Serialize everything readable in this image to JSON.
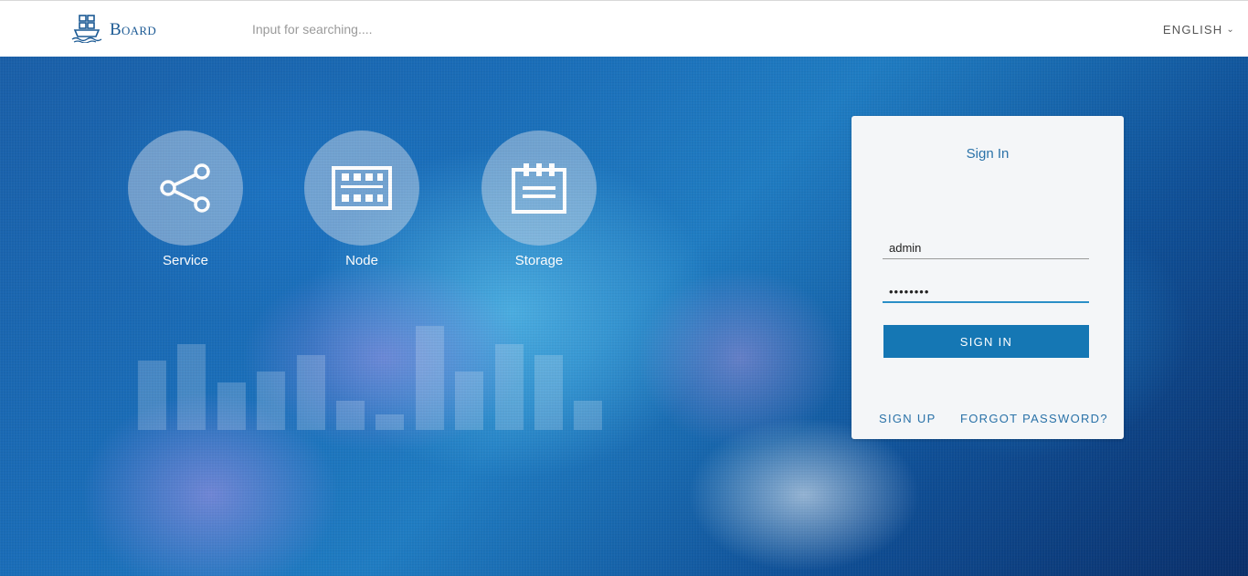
{
  "header": {
    "logo_text": "Board",
    "logo_icon": "ship-containers-icon",
    "search": {
      "placeholder": "Input for searching....",
      "value": ""
    },
    "language": "ENGLISH"
  },
  "features": [
    {
      "label": "Service",
      "icon": "share-icon"
    },
    {
      "label": "Node",
      "icon": "server-node-icon"
    },
    {
      "label": "Storage",
      "icon": "storage-box-icon"
    }
  ],
  "decor_bars": {
    "values": [
      76,
      94,
      52,
      64,
      82,
      32,
      17,
      114,
      64,
      94,
      82,
      32
    ]
  },
  "login": {
    "title": "Sign In",
    "username_value": "admin",
    "password_value": "••••••••",
    "signin_label": "SIGN IN",
    "signup_label": "SIGN UP",
    "forgot_label": "FORGOT PASSWORD?"
  },
  "colors": {
    "brand": "#1c5a94",
    "button": "#1577b4",
    "link": "#2a72a8"
  }
}
